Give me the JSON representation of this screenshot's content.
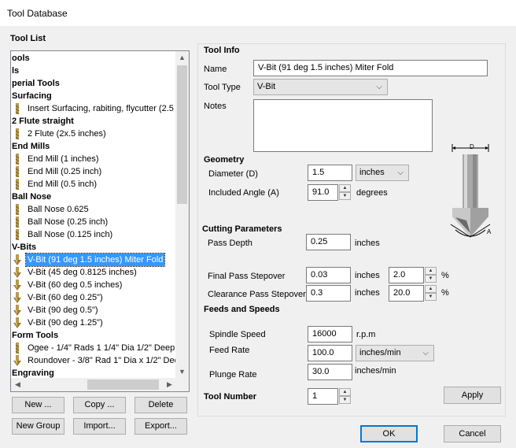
{
  "window": {
    "title": "Tool Database"
  },
  "tool_list": {
    "heading": "Tool List",
    "rows": [
      {
        "type": "group",
        "label": "ools"
      },
      {
        "type": "group",
        "label": "ls"
      },
      {
        "type": "group",
        "label": "perial Tools"
      },
      {
        "type": "group",
        "label": "Surfacing"
      },
      {
        "type": "item",
        "label": "Insert Surfacing, rabiting, flycutter (2.5",
        "icon": "flat-bit-icon"
      },
      {
        "type": "group",
        "label": "2 Flute straight"
      },
      {
        "type": "item",
        "label": "2 Flute (2x.5 inches)",
        "icon": "flat-bit-icon"
      },
      {
        "type": "group",
        "label": "End Mills"
      },
      {
        "type": "item",
        "label": "End Mill (1 inches)",
        "icon": "flat-bit-icon"
      },
      {
        "type": "item",
        "label": "End Mill (0.25 inch)",
        "icon": "flat-bit-icon"
      },
      {
        "type": "item",
        "label": "End Mill (0.5 inch)",
        "icon": "flat-bit-icon"
      },
      {
        "type": "group",
        "label": "Ball Nose"
      },
      {
        "type": "item",
        "label": "Ball Nose 0.625",
        "icon": "flat-bit-icon"
      },
      {
        "type": "item",
        "label": "Ball Nose (0.25 inch)",
        "icon": "flat-bit-icon"
      },
      {
        "type": "item",
        "label": "Ball Nose (0.125 inch)",
        "icon": "flat-bit-icon"
      },
      {
        "type": "group",
        "label": "V-Bits"
      },
      {
        "type": "item",
        "label": "V-Bit (91 deg 1.5 inches) Miter Fold",
        "icon": "vbit-icon",
        "selected": true
      },
      {
        "type": "item",
        "label": "V-Bit (45 deg 0.8125 inches)",
        "icon": "vbit-icon"
      },
      {
        "type": "item",
        "label": "V-Bit (60 deg 0.5 inches)",
        "icon": "vbit-icon"
      },
      {
        "type": "item",
        "label": "V-Bit (60 deg 0.25\")",
        "icon": "vbit-icon"
      },
      {
        "type": "item",
        "label": "V-Bit (90 deg 0.5\")",
        "icon": "vbit-icon"
      },
      {
        "type": "item",
        "label": "V-Bit (90 deg 1.25\")",
        "icon": "vbit-icon"
      },
      {
        "type": "group",
        "label": "Form Tools"
      },
      {
        "type": "item",
        "label": "Ogee - 1/4\" Rads 1 1/4\" Dia 1/2\" Deep",
        "icon": "flat-bit-icon"
      },
      {
        "type": "item",
        "label": "Roundover - 3/8\" Rad 1\" Dia x 1/2\" Dee",
        "icon": "vbit-icon"
      },
      {
        "type": "group",
        "label": "Engraving"
      }
    ]
  },
  "list_buttons": {
    "new": "New ...",
    "copy": "Copy ...",
    "delete": "Delete",
    "new_group": "New Group",
    "import": "Import...",
    "export": "Export..."
  },
  "tool_info": {
    "heading": "Tool Info",
    "name_label": "Name",
    "name_value": "V-Bit (91 deg 1.5 inches) Miter Fold",
    "type_label": "Tool Type",
    "type_value": "V-Bit",
    "notes_label": "Notes"
  },
  "geometry": {
    "heading": "Geometry",
    "diameter_label": "Diameter (D)",
    "diameter_value": "1.5",
    "diameter_units": "inches",
    "angle_label": "Included Angle (A)",
    "angle_value": "91.0",
    "angle_units": "degrees",
    "diagram_d": "D",
    "diagram_a": "A"
  },
  "cutting": {
    "heading": "Cutting Parameters",
    "pass_depth_label": "Pass Depth",
    "pass_depth_value": "0.25",
    "pass_depth_units": "inches",
    "final_label": "Final Pass Stepover",
    "final_value": "0.03",
    "final_units": "inches",
    "final_pct": "2.0",
    "clearance_label": "Clearance Pass Stepover",
    "clearance_value": "0.3",
    "clearance_units": "inches",
    "clearance_pct": "20.0",
    "pct_sign": "%"
  },
  "feeds": {
    "heading": "Feeds and Speeds",
    "spindle_label": "Spindle Speed",
    "spindle_value": "16000",
    "spindle_units": "r.p.m",
    "feed_label": "Feed Rate",
    "feed_value": "100.0",
    "feed_units": "inches/min",
    "plunge_label": "Plunge Rate",
    "plunge_value": "30.0",
    "plunge_units": "inches/min"
  },
  "tool_number": {
    "label": "Tool Number",
    "value": "1"
  },
  "buttons": {
    "apply": "Apply",
    "ok": "OK",
    "cancel": "Cancel"
  },
  "colors": {
    "selection": "#3399ff",
    "dialog_bg": "#f0f0f0",
    "default_border": "#0078d7"
  }
}
